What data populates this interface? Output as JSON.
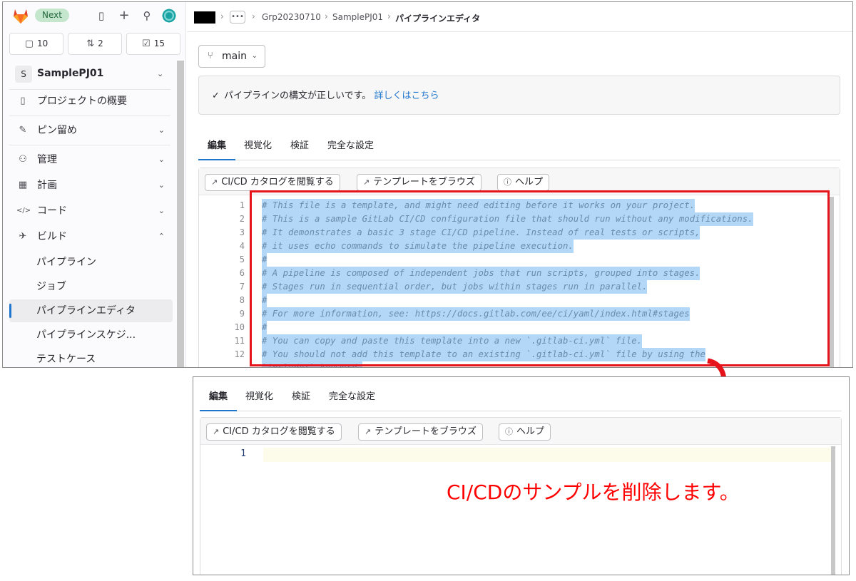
{
  "sidebar": {
    "badge": "Next",
    "counters": [
      {
        "icon": "issues-icon",
        "glyph": "▢",
        "value": "10"
      },
      {
        "icon": "merge-request-icon",
        "glyph": "⇅",
        "value": "2"
      },
      {
        "icon": "todo-icon",
        "glyph": "☑",
        "value": "15"
      }
    ],
    "project_initial": "S",
    "project_name": "SamplePJ01",
    "nav": [
      {
        "label": "プロジェクトの概要",
        "glyph": "▯"
      },
      {
        "label": "ピン留め",
        "glyph": "✎"
      },
      {
        "label": "管理",
        "glyph": "⚇"
      },
      {
        "label": "計画",
        "glyph": "▦"
      },
      {
        "label": "コード",
        "glyph": "</>"
      },
      {
        "label": "ビルド",
        "glyph": "✈"
      }
    ],
    "sub": [
      "パイプライン",
      "ジョブ",
      "パイプラインエディタ",
      "パイプラインスケジ...",
      "テストケース"
    ]
  },
  "breadcrumb": {
    "dots": "•••",
    "items": [
      "Grp20230710",
      "SamplePJ01",
      "パイプラインエディタ"
    ]
  },
  "branch": "main",
  "alert": {
    "check": "✓",
    "text": "パイプラインの構文が正しいです。",
    "link": "詳しくはこちら"
  },
  "tabs": [
    "編集",
    "視覚化",
    "検証",
    "完全な設定"
  ],
  "toolbar": {
    "catalog": "CI/CD カタログを閲覧する",
    "templates": "テンプレートをブラウズ",
    "help": "ヘルプ"
  },
  "code_lines": [
    {
      "n": "1",
      "text": "# This file is a template, and might need editing before it works on your project."
    },
    {
      "n": "2",
      "text": "# This is a sample GitLab CI/CD configuration file that should run without any modifications."
    },
    {
      "n": "3",
      "text": "# It demonstrates a basic 3 stage CI/CD pipeline. Instead of real tests or scripts,"
    },
    {
      "n": "4",
      "text": "# it uses echo commands to simulate the pipeline execution."
    },
    {
      "n": "5",
      "text": "#"
    },
    {
      "n": "6",
      "text": "# A pipeline is composed of independent jobs that run scripts, grouped into stages."
    },
    {
      "n": "7",
      "text": "# Stages run in sequential order, but jobs within stages run in parallel."
    },
    {
      "n": "8",
      "text": "#"
    },
    {
      "n": "9",
      "text": "# For more information, see: https://docs.gitlab.com/ee/ci/yaml/index.html#stages"
    },
    {
      "n": "10",
      "text": "#"
    },
    {
      "n": "11",
      "text": "# You can copy and paste this template into a new `.gitlab-ci.yml` file."
    },
    {
      "n": "12",
      "text": "# You should not add this template to an existing `.gitlab-ci.yml` file by using the"
    },
    {
      "n": "",
      "text": "`include:` keyword."
    }
  ],
  "after": {
    "line_number": "1",
    "caption": "CI/CDのサンプルを削除します。"
  },
  "colors": {
    "annotation_red": "#ff0000",
    "accent_blue": "#1f75cb",
    "selection": "#b3d7f6"
  }
}
